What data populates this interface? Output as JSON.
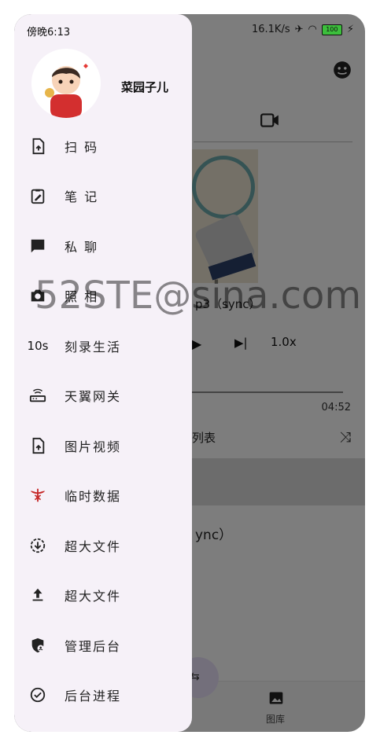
{
  "status": {
    "time": "傍晚6:13",
    "speed": "16.1K/s",
    "battery": "100"
  },
  "drawer": {
    "username": "菜园子儿",
    "items": [
      {
        "label": "扫 码",
        "icon": "upload-file-icon"
      },
      {
        "label": "笔 记",
        "icon": "edit-clipboard-icon"
      },
      {
        "label": "私 聊",
        "icon": "chat-bubble-icon"
      },
      {
        "label": "照 相",
        "icon": "camera-icon"
      },
      {
        "label": "刻录生活",
        "icon": "10s",
        "icon_text": "10s"
      },
      {
        "label": "天翼网关",
        "icon": "router-icon"
      },
      {
        "label": "图片视频",
        "icon": "upload-file-icon"
      },
      {
        "label": "临时数据",
        "icon": "caduceus-icon"
      },
      {
        "label": "超大文件",
        "icon": "download-circle-icon"
      },
      {
        "label": "超大文件",
        "icon": "upload-arrow-icon"
      },
      {
        "label": "管理后台",
        "icon": "admin-shield-icon"
      },
      {
        "label": "后台进程",
        "icon": "check-circle-icon"
      }
    ]
  },
  "player": {
    "track_title": "p3（sync）",
    "speed": "1.0x",
    "duration": "04:52",
    "playlist_label": "列表",
    "list_item_tail": "ync）"
  },
  "bottom_nav": {
    "gallery_label": "图库"
  },
  "watermark": "52STE@sina.com",
  "colors": {
    "drawer_bg": "#f6f1f8",
    "scrim": "rgba(0,0,0,0.5)",
    "accent_red": "#c62828",
    "battery": "#3cbf3c"
  }
}
